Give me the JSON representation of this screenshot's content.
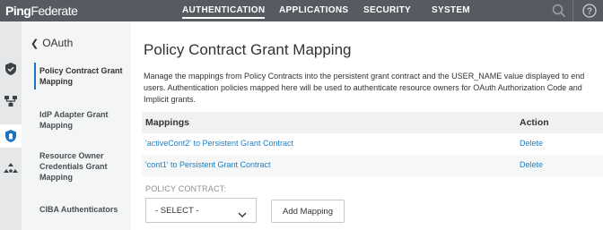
{
  "app": {
    "logo_bold": "Ping",
    "logo_light": "Federate"
  },
  "nav": {
    "items": [
      {
        "label": "AUTHENTICATION",
        "active": true
      },
      {
        "label": "APPLICATIONS",
        "active": false
      },
      {
        "label": "SECURITY",
        "active": false
      },
      {
        "label": "SYSTEM",
        "active": false
      }
    ],
    "icons": [
      "search-icon",
      "help-icon"
    ]
  },
  "rail": {
    "icons": [
      "shield-check-icon",
      "network-icon",
      "oauth-shield-icon",
      "tokens-icon"
    ],
    "active": "oauth-shield-icon"
  },
  "subnav": {
    "back_label": "OAuth",
    "items": [
      {
        "label": "Policy Contract Grant Mapping",
        "active": true
      },
      {
        "label": "IdP Adapter Grant Mapping",
        "active": false
      },
      {
        "label": "Resource Owner Credentials Grant Mapping",
        "active": false
      },
      {
        "label": "CIBA Authenticators",
        "active": false
      }
    ]
  },
  "main": {
    "title": "Policy Contract Grant Mapping",
    "description": "Manage the mappings from Policy Contracts into the persistent grant contract and the USER_NAME value displayed to end users. Authentication policies mapped here will be used to authenticate resource owners for OAuth Authorization Code and Implicit grants.",
    "table": {
      "headers": [
        "Mappings",
        "Action"
      ],
      "rows": [
        {
          "mapping": "'activeCont2' to Persistent Grant Contract",
          "action": "Delete"
        },
        {
          "mapping": "'cont1' to Persistent Grant Contract",
          "action": "Delete"
        }
      ]
    },
    "policy_contract_label": "POLICY CONTRACT:",
    "select_value": "- SELECT -",
    "add_button": "Add Mapping"
  },
  "colors": {
    "topbar": "#565b61",
    "link": "#1e7fc4",
    "accent": "#1e73be",
    "rail": "#e6e7e8",
    "subnav": "#f4f5f5"
  }
}
